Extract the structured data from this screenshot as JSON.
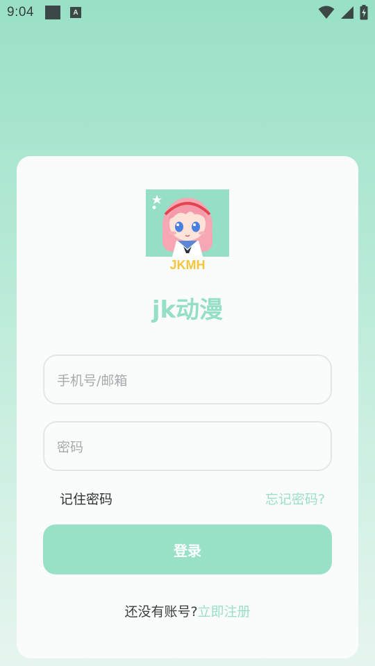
{
  "status_bar": {
    "time": "9:04",
    "a_icon_letter": "A",
    "icons": [
      "notification-square-icon",
      "a-notification-icon",
      "wifi-icon",
      "signal-icon",
      "battery-charging-icon"
    ]
  },
  "login": {
    "logo_text": "JKMH",
    "app_name": "jk动漫",
    "account_placeholder": "手机号/邮箱",
    "password_placeholder": "密码",
    "remember_label": "记住密码",
    "forgot_label": "忘记密码?",
    "login_button": "登录",
    "register_prompt": "还没有账号?",
    "register_link": "立即注册"
  },
  "colors": {
    "accent": "#98e1c7",
    "background_top": "#99e0c6",
    "card": "#f9fcfb"
  }
}
